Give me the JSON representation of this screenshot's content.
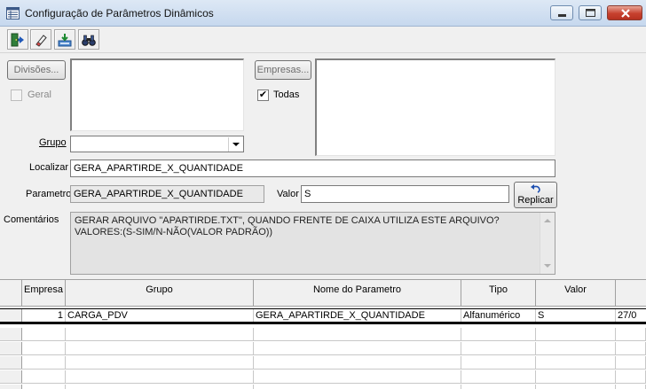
{
  "window": {
    "title": "Configuração de Parâmetros Dinâmicos"
  },
  "toolbar": {
    "icons": [
      "exit-door-icon",
      "eraser-icon",
      "save-download-icon",
      "binoculars-icon"
    ]
  },
  "filters": {
    "divisoes_button": "Divisões...",
    "geral_label": "Geral",
    "geral_checked": false,
    "empresas_button": "Empresas...",
    "todas_label": "Todas",
    "todas_checked": true,
    "todas_mark": "✔",
    "grupo_label": "Grupo",
    "grupo_value": "",
    "localizar_label": "Localizar",
    "localizar_value": "GERA_APARTIRDE_X_QUANTIDADE",
    "parametro_label": "Parametro",
    "parametro_value": "GERA_APARTIRDE_X_QUANTIDADE",
    "valor_label": "Valor",
    "valor_value": "S",
    "replicar_button": "Replicar",
    "comentarios_label": "Comentários",
    "comentarios_lines": [
      "GERAR ARQUIVO \"APARTIRDE.TXT\", QUANDO FRENTE DE CAIXA UTILIZA ESTE ARQUIVO?",
      "VALORES:(S-SIM/N-NÃO(VALOR PADRÃO))"
    ]
  },
  "grid": {
    "columns": [
      "Empresa",
      "Grupo",
      "Nome do Parametro",
      "Tipo",
      "Valor"
    ],
    "rows": [
      {
        "empresa": "1",
        "grupo": "CARGA_PDV",
        "nome": "GERA_APARTIRDE_X_QUANTIDADE",
        "tipo": "Alfanumérico",
        "valor": "S",
        "extra": "27/0"
      }
    ]
  },
  "colors": {
    "titlebar": "#c6d8ee",
    "close_button": "#c7412f",
    "window_bg": "#f0f0f0",
    "memo_bg": "#e3e3e3"
  }
}
